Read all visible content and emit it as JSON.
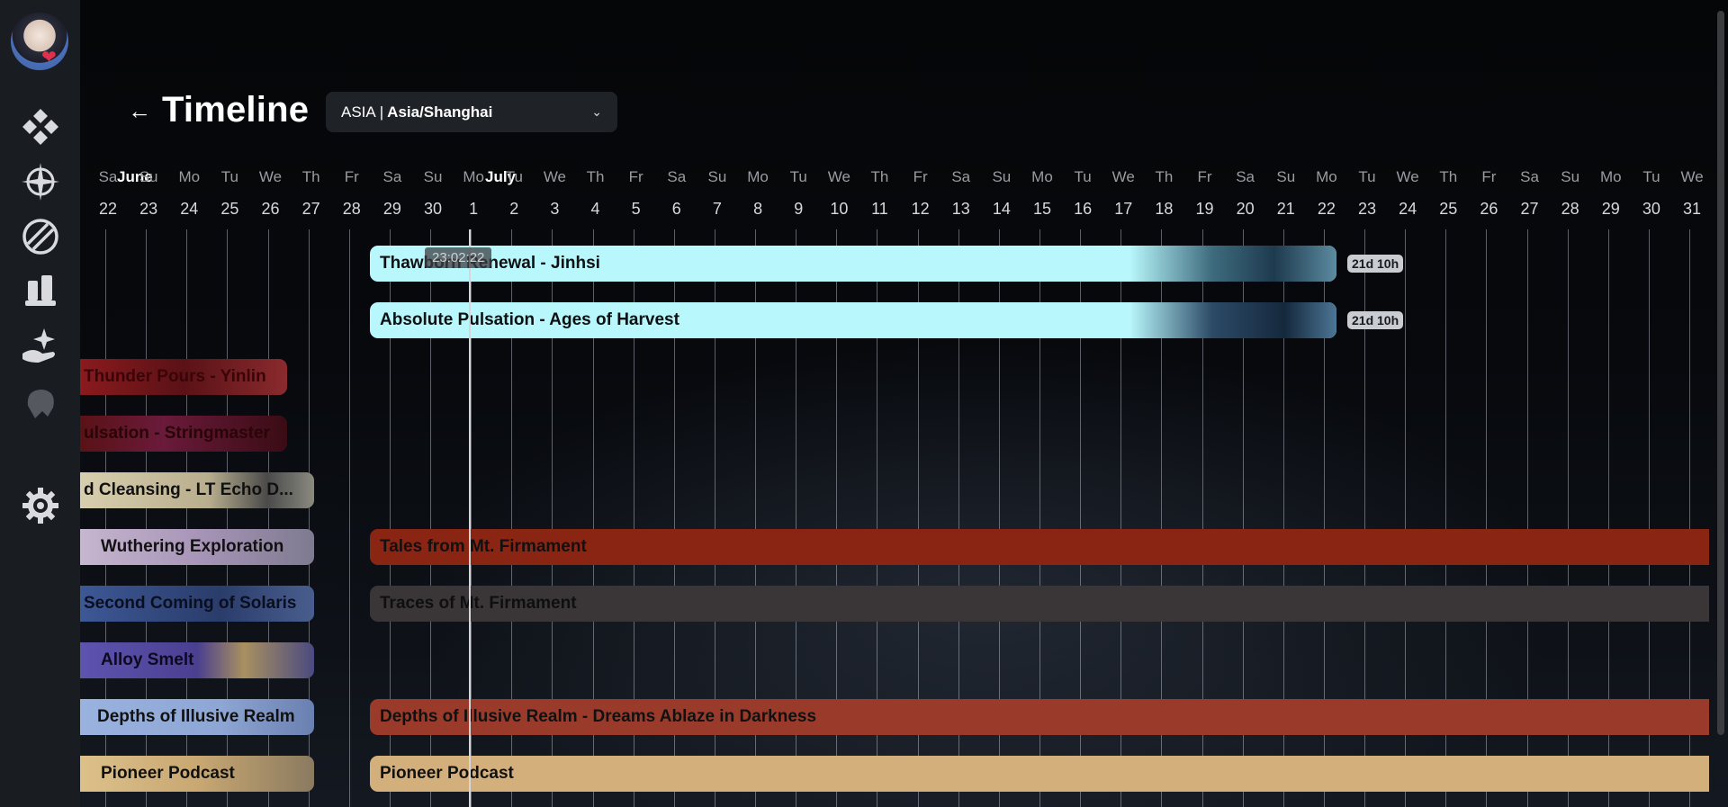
{
  "sidebar": {
    "avatar_icon": "avatar-chibi-girl-icon",
    "items": [
      {
        "name": "sidebar-item-gacha",
        "icon": "diamond-cluster-icon"
      },
      {
        "name": "sidebar-item-resonators",
        "icon": "compass-star-icon"
      },
      {
        "name": "sidebar-item-weapons",
        "icon": "circle-emblem-icon"
      },
      {
        "name": "sidebar-item-echoes",
        "icon": "chess-pieces-icon"
      },
      {
        "name": "sidebar-item-events",
        "icon": "sparkle-hand-icon"
      },
      {
        "name": "sidebar-item-character",
        "icon": "character-head-icon"
      },
      {
        "name": "sidebar-item-settings",
        "icon": "gear-icon"
      }
    ]
  },
  "header": {
    "back_icon": "arrow-left-icon",
    "title": "Timeline",
    "tz_region": "ASIA",
    "tz_separator": "|",
    "tz_zone": "Asia/Shanghai"
  },
  "timeline": {
    "months": [
      {
        "label": "June"
      },
      {
        "label": "July"
      }
    ],
    "days": [
      {
        "dow": "Sa",
        "dom": "22"
      },
      {
        "dow": "Su",
        "dom": "23"
      },
      {
        "dow": "Mo",
        "dom": "24"
      },
      {
        "dow": "Tu",
        "dom": "25"
      },
      {
        "dow": "We",
        "dom": "26"
      },
      {
        "dow": "Th",
        "dom": "27"
      },
      {
        "dow": "Fr",
        "dom": "28"
      },
      {
        "dow": "Sa",
        "dom": "29"
      },
      {
        "dow": "Su",
        "dom": "30"
      },
      {
        "dow": "Mo",
        "dom": "1"
      },
      {
        "dow": "Tu",
        "dom": "2"
      },
      {
        "dow": "We",
        "dom": "3"
      },
      {
        "dow": "Th",
        "dom": "4"
      },
      {
        "dow": "Fr",
        "dom": "5"
      },
      {
        "dow": "Sa",
        "dom": "6"
      },
      {
        "dow": "Su",
        "dom": "7"
      },
      {
        "dow": "Mo",
        "dom": "8"
      },
      {
        "dow": "Tu",
        "dom": "9"
      },
      {
        "dow": "We",
        "dom": "10"
      },
      {
        "dow": "Th",
        "dom": "11"
      },
      {
        "dow": "Fr",
        "dom": "12"
      },
      {
        "dow": "Sa",
        "dom": "13"
      },
      {
        "dow": "Su",
        "dom": "14"
      },
      {
        "dow": "Mo",
        "dom": "15"
      },
      {
        "dow": "Tu",
        "dom": "16"
      },
      {
        "dow": "We",
        "dom": "17"
      },
      {
        "dow": "Th",
        "dom": "18"
      },
      {
        "dow": "Fr",
        "dom": "19"
      },
      {
        "dow": "Sa",
        "dom": "20"
      },
      {
        "dow": "Su",
        "dom": "21"
      },
      {
        "dow": "Mo",
        "dom": "22"
      },
      {
        "dow": "Tu",
        "dom": "23"
      },
      {
        "dow": "We",
        "dom": "24"
      },
      {
        "dow": "Th",
        "dom": "25"
      },
      {
        "dow": "Fr",
        "dom": "26"
      },
      {
        "dow": "Sa",
        "dom": "27"
      },
      {
        "dow": "Su",
        "dom": "28"
      },
      {
        "dow": "Mo",
        "dom": "29"
      },
      {
        "dow": "Tu",
        "dom": "30"
      },
      {
        "dow": "We",
        "dom": "31"
      }
    ],
    "now_time": "23:02:22",
    "events": [
      {
        "label": "Thawborn Renewal - Jinhsi",
        "color": "#b8f7fb",
        "remaining": "21d 10h"
      },
      {
        "label": "Absolute Pulsation - Ages of Harvest",
        "color": "#b8f7fb",
        "remaining": "21d 10h"
      },
      {
        "label": "Thunder Pours - Yinlin",
        "color": "#7a1418"
      },
      {
        "label": "ulsation - Stringmaster",
        "color": "#6a1418"
      },
      {
        "label": "d Cleansing - LT Echo D...",
        "color": "#cfc6a6"
      },
      {
        "label": "Wuthering Exploration",
        "color": "#b9a9c4"
      },
      {
        "label": "Tales from Mt. Firmament",
        "color": "#8a2413"
      },
      {
        "label": "Second Coming of Solaris",
        "color": "#3a4f86"
      },
      {
        "label": "Traces of Mt. Firmament",
        "color": "#3a3638"
      },
      {
        "label": "Alloy Smelt",
        "color": "#5a4fa8"
      },
      {
        "label": "Depths of Illusive Realm",
        "color": "#8ea6d4"
      },
      {
        "label": "Depths of Illusive Realm - Dreams Ablaze in Darkness",
        "color": "#9a3a2a"
      },
      {
        "label": "Pioneer Podcast",
        "color": "#d7b67e"
      },
      {
        "label": "Pioneer Podcast",
        "color": "#d3af7c"
      }
    ]
  }
}
